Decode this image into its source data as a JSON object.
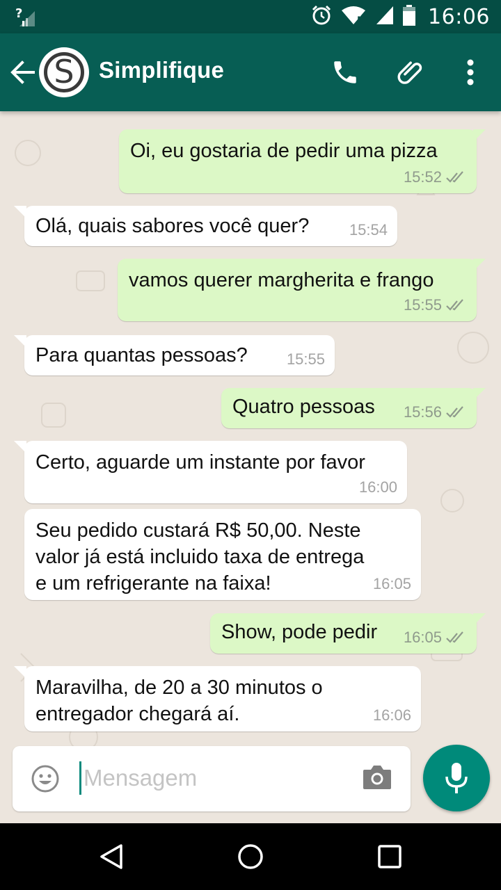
{
  "status_bar": {
    "time": "16:06",
    "icons": [
      "signal-unknown-icon",
      "alarm-icon",
      "wifi-icon",
      "cell-signal-icon",
      "battery-icon"
    ]
  },
  "header": {
    "contact_name": "Simplifique",
    "avatar_letter": "S",
    "actions": [
      "phone-icon",
      "attach-icon",
      "more-icon"
    ]
  },
  "messages": [
    {
      "dir": "out",
      "text": "Oi, eu gostaria de pedir uma pizza",
      "time": "15:52",
      "read": true
    },
    {
      "dir": "in",
      "text": "Olá, quais sabores você quer?",
      "time": "15:54"
    },
    {
      "dir": "out",
      "text": "vamos querer margherita e frango",
      "time": "15:55",
      "read": true
    },
    {
      "dir": "in",
      "text": "Para quantas pessoas?",
      "time": "15:55"
    },
    {
      "dir": "out",
      "text": "Quatro pessoas",
      "time": "15:56",
      "read": true
    },
    {
      "dir": "in",
      "text": "Certo, aguarde um instante por favor",
      "time": "16:00"
    },
    {
      "dir": "in",
      "text": "Seu pedido custará R$ 50,00. Neste\nvalor já está incluido taxa de entrega\ne um refrigerante na faixa!",
      "time": "16:05"
    },
    {
      "dir": "out",
      "text": "Show, pode pedir",
      "time": "16:05",
      "read": true
    },
    {
      "dir": "in",
      "text": "Maravilha, de 20 a 30 minutos o\nentregador chegará aí.",
      "time": "16:06"
    }
  ],
  "composer": {
    "placeholder": "Mensagem",
    "value": ""
  },
  "colors": {
    "header": "#075e54",
    "status_bar": "#054d44",
    "outgoing_bubble": "#dcf8c6",
    "incoming_bubble": "#ffffff",
    "chat_background": "#ece5dd",
    "mic_button": "#008a7a",
    "read_ticks": "#8f9a8c"
  }
}
